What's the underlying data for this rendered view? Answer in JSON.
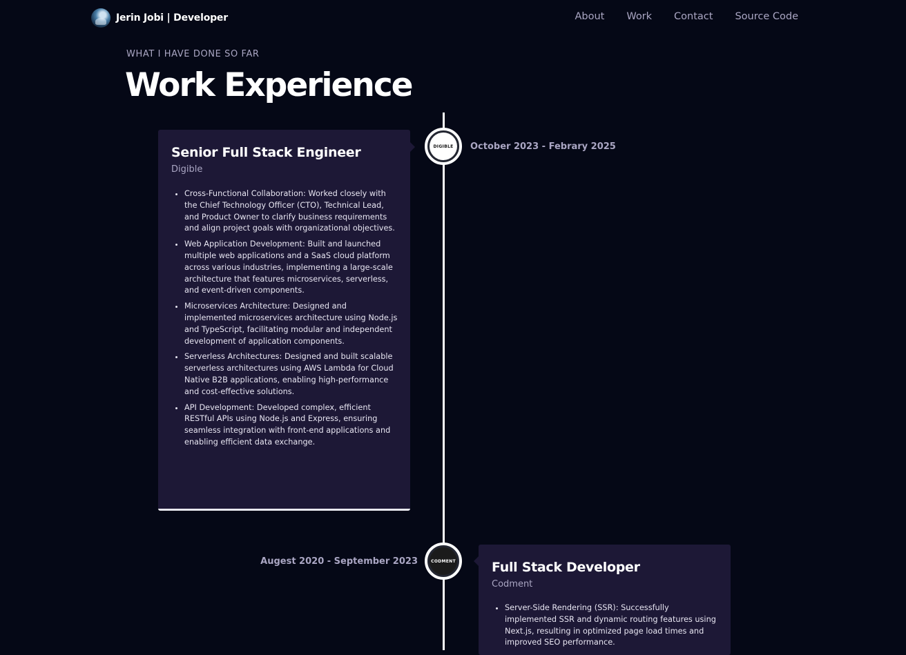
{
  "nav": {
    "brand": "Jerin Jobi | Developer",
    "links": [
      "About",
      "Work",
      "Contact",
      "Source Code"
    ]
  },
  "section": {
    "subtitle": "What I have done so far",
    "title": "Work Experience"
  },
  "experiences": [
    {
      "title": "Senior Full Stack Engineer",
      "company": "Digible",
      "date": "October 2023 - Febrary 2025",
      "icon_label": "DIGIBLE",
      "icon_bg": "#ffffff",
      "points": [
        "Cross-Functional Collaboration: Worked closely with the Chief Technology Officer (CTO), Technical Lead, and Product Owner to clarify business requirements and align project goals with organizational objectives.",
        "Web Application Development: Built and launched multiple web applications and a SaaS cloud platform across various industries, implementing a large-scale architecture that features microservices, serverless, and event-driven components.",
        "Microservices Architecture: Designed and implemented microservices architecture using Node.js and TypeScript, facilitating modular and independent development of application components.",
        "Serverless Architectures: Designed and built scalable serverless architectures using AWS Lambda for Cloud Native B2B applications, enabling high-performance and cost-effective solutions.",
        "API Development: Developed complex, efficient RESTful APIs using Node.js and Express, ensuring seamless integration with front-end applications and enabling efficient data exchange."
      ]
    },
    {
      "title": "Full Stack Developer",
      "company": "Codment",
      "date": "Augest 2020 - September 2023",
      "icon_label": "CODMENT",
      "icon_bg": "#1b1b1b",
      "points": [
        "Server-Side Rendering (SSR): Successfully implemented SSR and dynamic routing features using Next.js, resulting in optimized page load times and improved SEO performance."
      ]
    }
  ],
  "colors": {
    "background": "#050816",
    "card": "#1d1836",
    "secondary_text": "#aaa6c3",
    "timeline": "#ffffff"
  }
}
